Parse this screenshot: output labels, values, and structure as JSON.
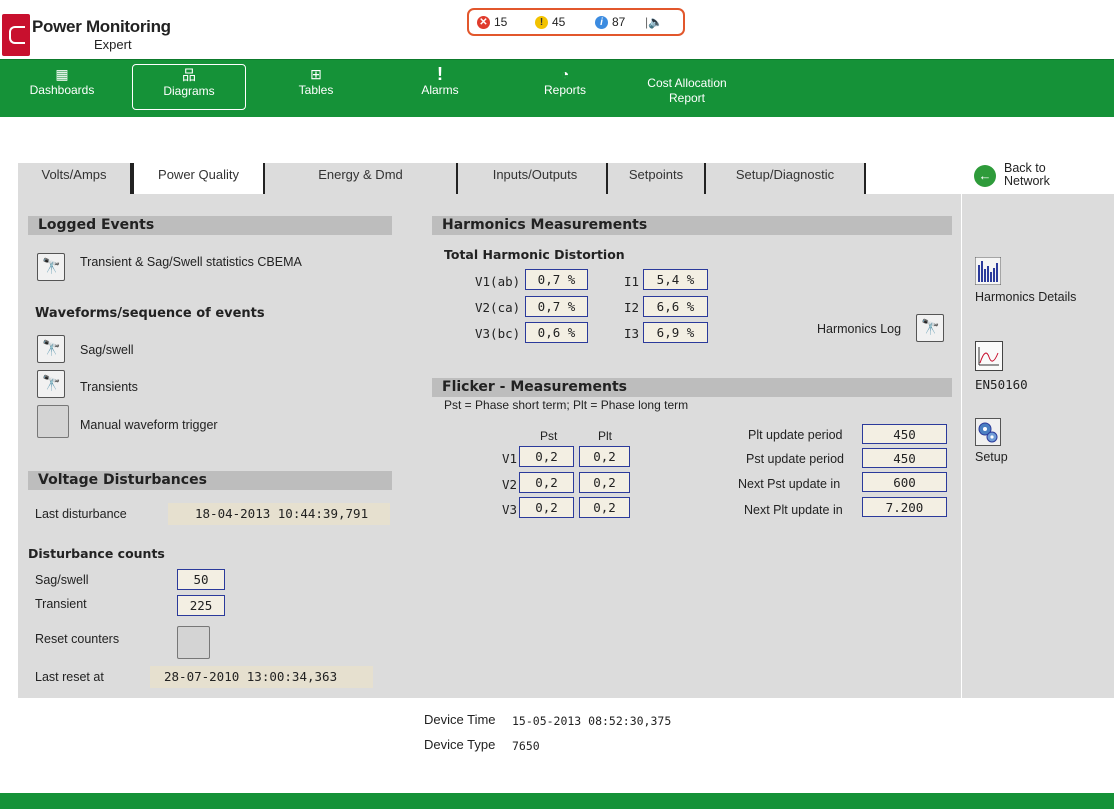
{
  "brand": {
    "title": "Power Monitoring",
    "subtitle": "Expert"
  },
  "alarm_bar": {
    "errors": "15",
    "warnings": "45",
    "info": "87"
  },
  "nav": [
    {
      "label": "Dashboards"
    },
    {
      "label": "Diagrams"
    },
    {
      "label": "Tables"
    },
    {
      "label": "Alarms"
    },
    {
      "label": "Reports"
    },
    {
      "label_line1": "Cost Allocation",
      "label_line2": "Report"
    }
  ],
  "tabs": [
    "Volts/Amps",
    "Power Quality",
    "Energy & Dmd",
    "Inputs/Outputs",
    "Setpoints",
    "Setup/Diagnostic"
  ],
  "back_link": {
    "line1": "Back to",
    "line2": "Network"
  },
  "logged_events": {
    "title": "Logged Events",
    "cbema_label": "Transient & Sag/Swell statistics CBEMA",
    "waveforms_title": "Waveforms/sequence of events",
    "sag_swell_label": "Sag/swell",
    "transients_label": "Transients",
    "manual_trigger_label": "Manual waveform trigger"
  },
  "voltage_disturbances": {
    "title": "Voltage Disturbances",
    "last_disturbance_label": "Last disturbance",
    "last_disturbance_value": "18-04-2013 10:44:39,791",
    "counts_title": "Disturbance counts",
    "sag_swell_label": "Sag/swell",
    "sag_swell_value": "50",
    "transient_label": "Transient",
    "transient_value": "225",
    "reset_label": "Reset counters",
    "last_reset_label": "Last reset at",
    "last_reset_value": "28-07-2010 13:00:34,363"
  },
  "harmonics": {
    "title": "Harmonics Measurements",
    "thd_title": "Total Harmonic Distortion",
    "v_rows": [
      {
        "label": "V1(ab)",
        "value": "0,7 %"
      },
      {
        "label": "V2(ca)",
        "value": "0,7 %"
      },
      {
        "label": "V3(bc)",
        "value": "0,6 %"
      }
    ],
    "i_rows": [
      {
        "label": "I1",
        "value": "5,4 %"
      },
      {
        "label": "I2",
        "value": "6,6 %"
      },
      {
        "label": "I3",
        "value": "6,9 %"
      }
    ],
    "log_label": "Harmonics Log"
  },
  "flicker": {
    "title": "Flicker - Measurements",
    "subtitle": "Pst = Phase short term; Plt = Phase long term",
    "col_pst": "Pst",
    "col_plt": "Plt",
    "rows": [
      {
        "label": "V1",
        "pst": "0,2",
        "plt": "0,2"
      },
      {
        "label": "V2",
        "pst": "0,2",
        "plt": "0,2"
      },
      {
        "label": "V3",
        "pst": "0,2",
        "plt": "0,2"
      }
    ],
    "periods": [
      {
        "label": "Plt update period",
        "value": "450"
      },
      {
        "label": "Pst update period",
        "value": "450"
      },
      {
        "label": "Next Pst update in",
        "value": "600"
      },
      {
        "label": "Next Plt update in",
        "value": "7.200"
      }
    ]
  },
  "side": {
    "harmonics_details": "Harmonics Details",
    "en50160": "EN50160",
    "setup": "Setup"
  },
  "device": {
    "time_label": "Device Time",
    "time_value": "15-05-2013 08:52:30,375",
    "type_label": "Device Type",
    "type_value": "7650"
  },
  "colors": {
    "nav_green": "#159238",
    "accent_blue": "#2b3a9b",
    "panel_grey": "#dcdcdc",
    "alarm_red": "#e2572c"
  }
}
